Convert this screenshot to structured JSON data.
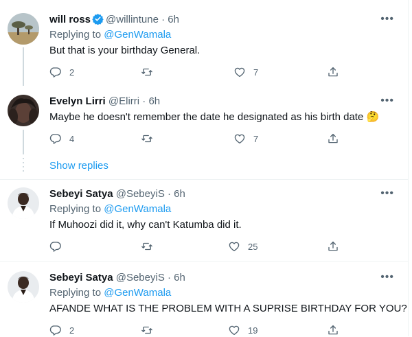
{
  "show_replies": "Show replies",
  "replying_prefix": "Replying to",
  "tweets": [
    {
      "name": "will ross",
      "handle": "@willintune",
      "time": "· 6h",
      "verified": true,
      "replying_to": "@GenWamala",
      "text": "But that is your birthday General.",
      "replies": "2",
      "retweets": "",
      "likes": "7"
    },
    {
      "name": "Evelyn Lirri",
      "handle": "@Elirri",
      "time": "· 6h",
      "verified": false,
      "text": "Maybe he doesn't remember the date he designated as his birth date 🤔",
      "replies": "4",
      "retweets": "",
      "likes": "7"
    },
    {
      "name": "Sebeyi Satya",
      "handle": "@SebeyiS",
      "time": "· 6h",
      "verified": false,
      "replying_to": "@GenWamala",
      "text": "If Muhoozi did it, why can't Katumba did it.",
      "replies": "",
      "retweets": "",
      "likes": "25"
    },
    {
      "name": "Sebeyi Satya",
      "handle": "@SebeyiS",
      "time": "· 6h",
      "verified": false,
      "replying_to": "@GenWamala",
      "text": "AFANDE WHAT IS THE PROBLEM WITH A SUPRISE BIRTHDAY FOR YOU?",
      "replies": "2",
      "retweets": "",
      "likes": "19"
    }
  ],
  "colors": {
    "accent": "#1d9bf0",
    "muted": "#536471",
    "text": "#0f1419",
    "divider": "#eff3f4"
  }
}
